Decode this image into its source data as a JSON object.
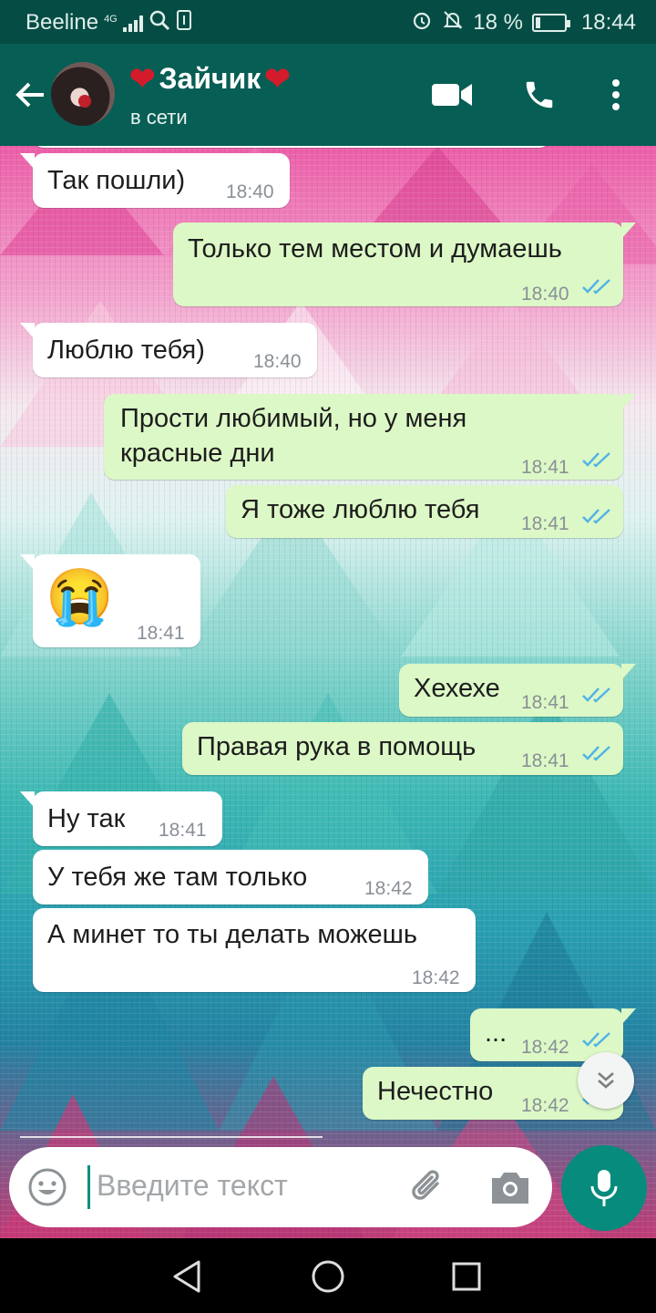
{
  "statusbar": {
    "carrier": "Beeline",
    "network": "4G",
    "battery_percent": "18 %",
    "battery_level": 0.18,
    "time": "18:44",
    "icons": [
      "signal-icon",
      "search-icon",
      "sim-icon",
      "alarm-icon",
      "mute-icon",
      "battery-icon"
    ]
  },
  "header": {
    "contact_name": "Зайчик",
    "name_decorations": [
      "heart-emoji",
      "heart-emoji"
    ],
    "heart_glyph": "❤",
    "status": "в сети",
    "icons": [
      "back-arrow-icon",
      "video-call-icon",
      "phone-icon",
      "more-vert-icon"
    ]
  },
  "messages": [
    {
      "dir": "in",
      "text": "Так пошли)",
      "time": "18:40"
    },
    {
      "dir": "out",
      "text": "Только тем местом и думаешь",
      "time": "18:40",
      "read": true
    },
    {
      "dir": "in",
      "text": "Люблю тебя)",
      "time": "18:40"
    },
    {
      "dir": "out",
      "text": "Прости любимый, но у меня красные дни",
      "time": "18:41",
      "read": true
    },
    {
      "dir": "out",
      "text": "Я тоже люблю тебя",
      "time": "18:41",
      "read": true
    },
    {
      "dir": "in",
      "emoji": "crying-face-emoji",
      "text": "😭",
      "time": "18:41"
    },
    {
      "dir": "out",
      "text": "Хехехе",
      "time": "18:41",
      "read": true
    },
    {
      "dir": "out",
      "text": "Правая рука в помощь",
      "time": "18:41",
      "read": true
    },
    {
      "dir": "in",
      "text": "Ну так",
      "time": "18:41"
    },
    {
      "dir": "in",
      "text": "У тебя же там только",
      "time": "18:42"
    },
    {
      "dir": "in",
      "text": "А минет то ты делать можешь",
      "time": "18:42"
    },
    {
      "dir": "out",
      "text": "...",
      "time": "18:42",
      "read": true
    },
    {
      "dir": "out",
      "text": "Нечестно",
      "time": "18:42",
      "read": true
    }
  ],
  "composer": {
    "placeholder": "Введите текст",
    "icons": [
      "emoji-icon",
      "attach-icon",
      "camera-icon",
      "mic-icon"
    ]
  },
  "navbar": {
    "icons": [
      "back-nav-icon",
      "home-nav-icon",
      "recents-nav-icon"
    ]
  },
  "colors": {
    "header": "#075e54",
    "statusbar": "#054d44",
    "outgoing_bubble": "#dcf8c6",
    "incoming_bubble": "#ffffff",
    "read_ticks": "#4fb3e8",
    "mic_button": "#068b7c"
  }
}
